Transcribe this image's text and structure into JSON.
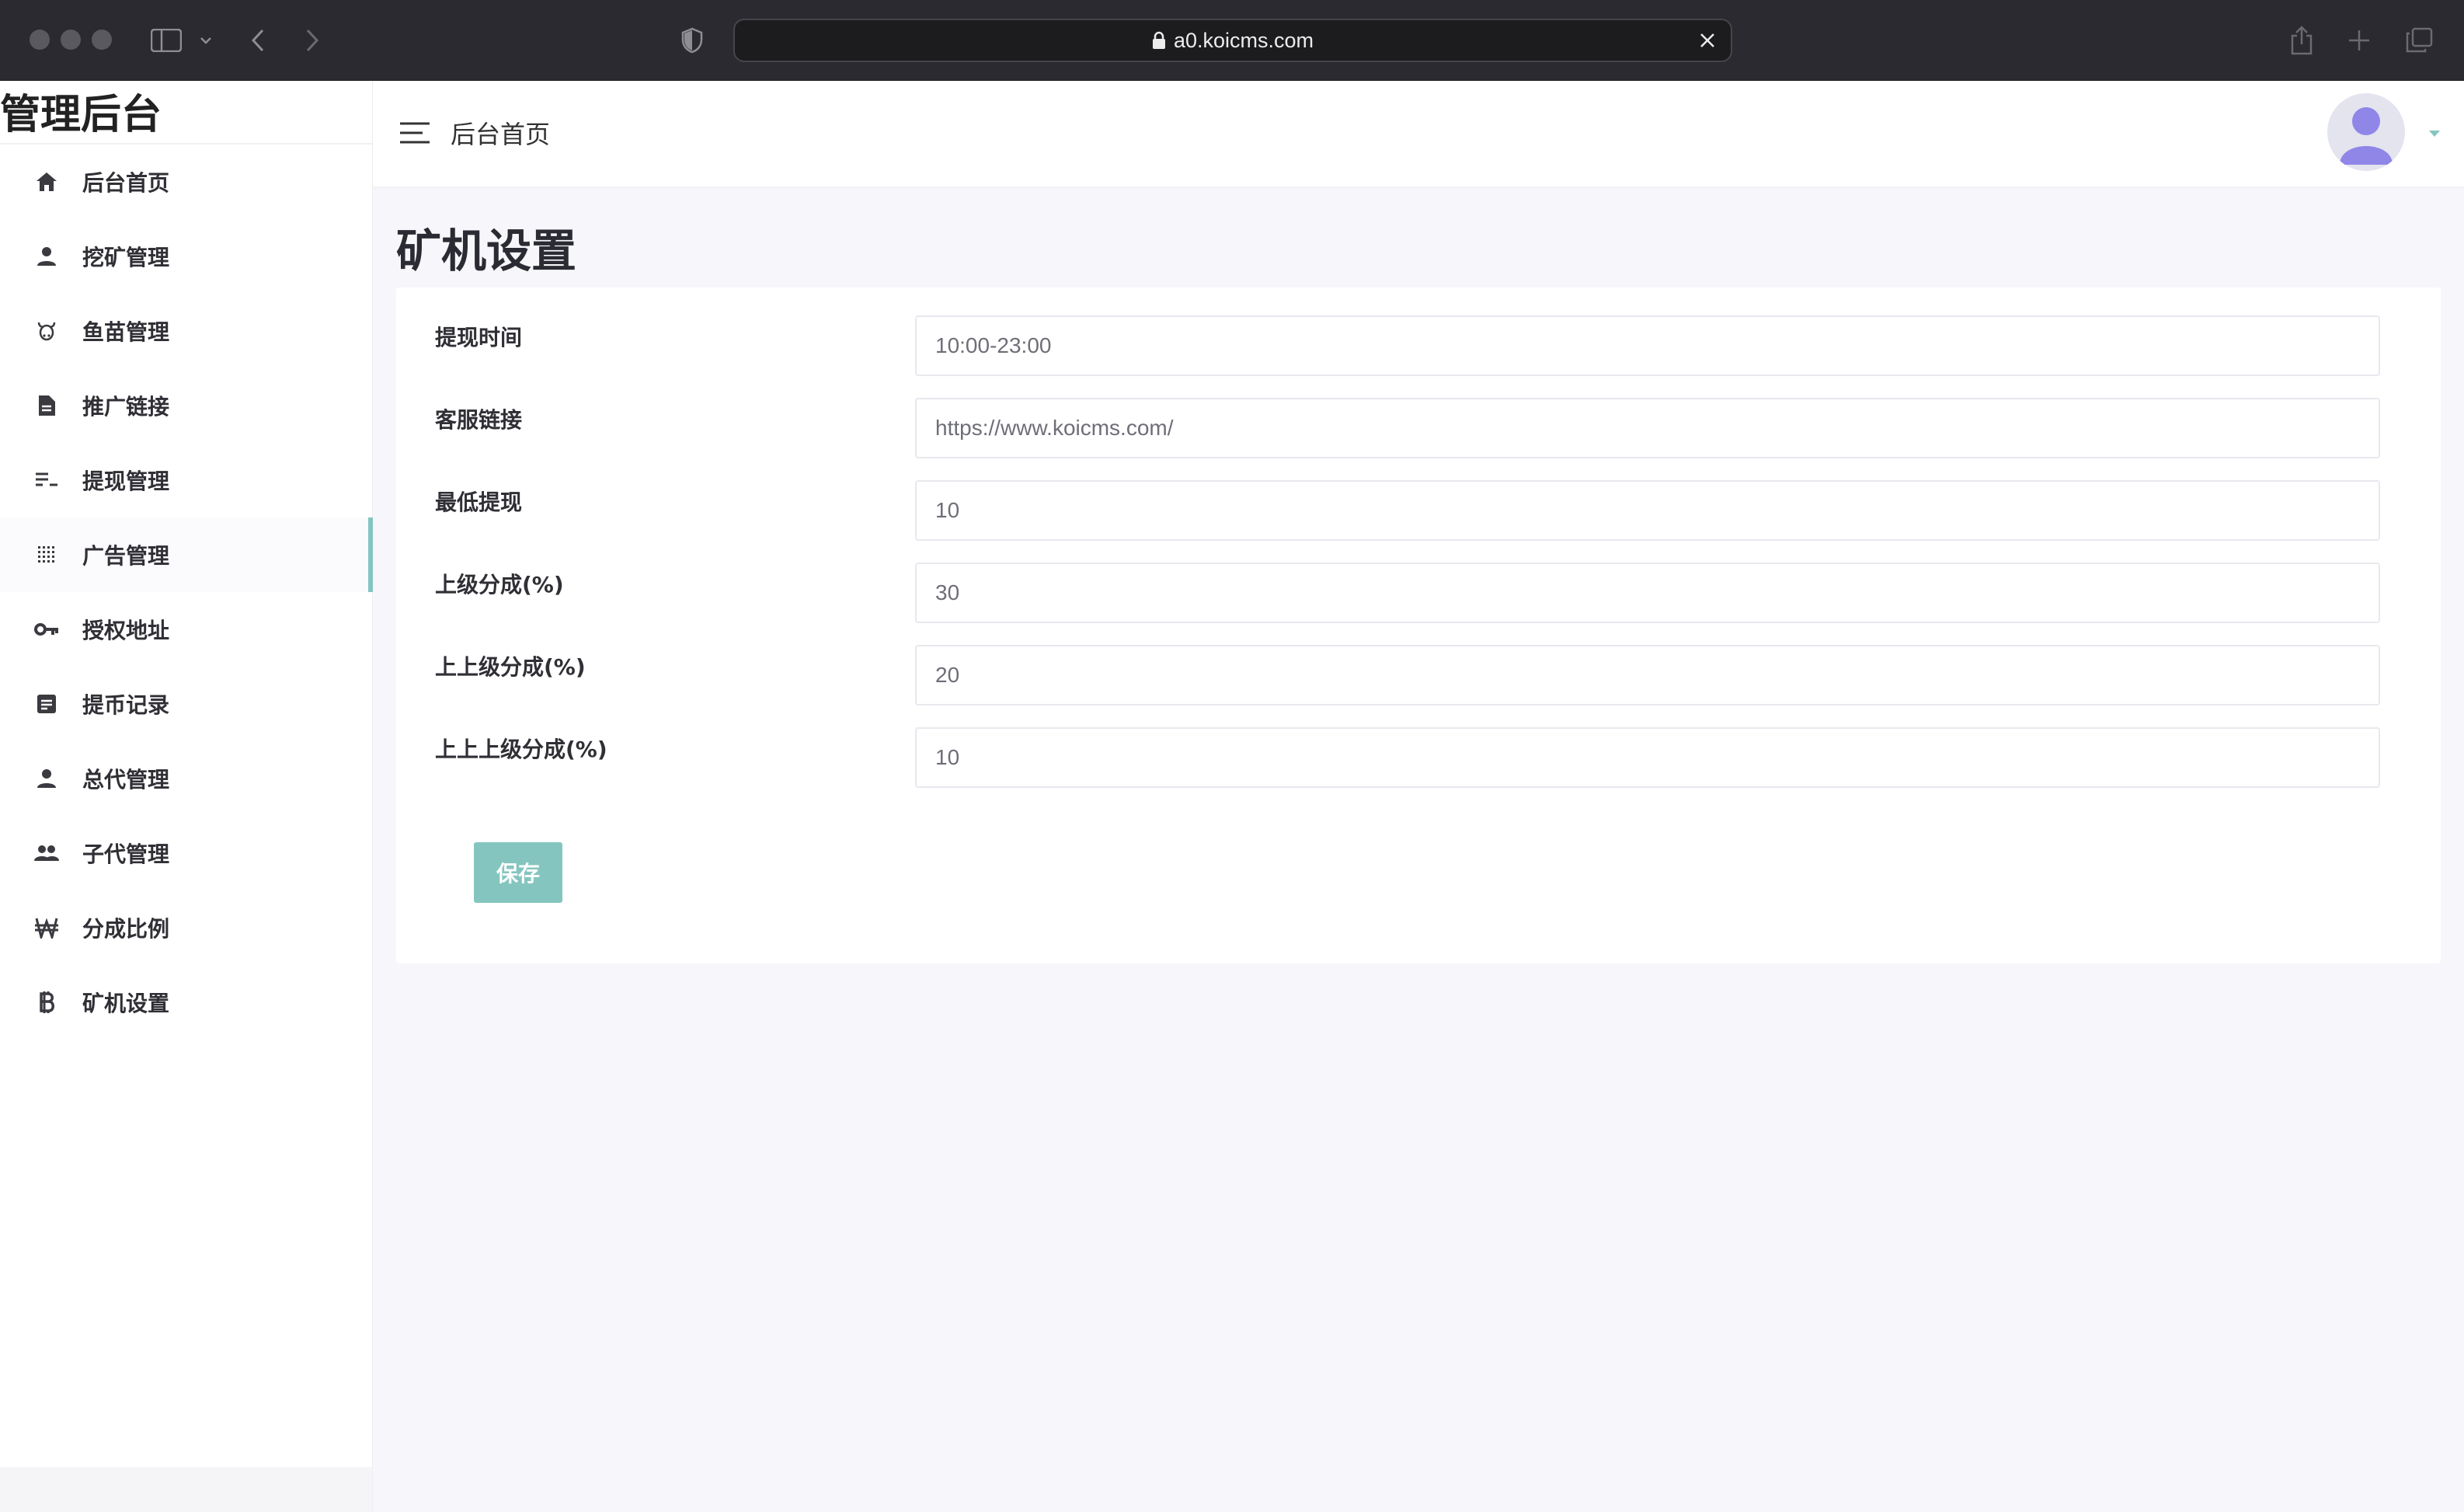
{
  "browser": {
    "url": "a0.koicms.com"
  },
  "sidebar": {
    "brand": "管理后台",
    "items": [
      {
        "label": "后台首页",
        "icon": "home-icon"
      },
      {
        "label": "挖矿管理",
        "icon": "person-icon"
      },
      {
        "label": "鱼苗管理",
        "icon": "cow-icon"
      },
      {
        "label": "推广链接",
        "icon": "document-icon"
      },
      {
        "label": "提现管理",
        "icon": "list-icon"
      },
      {
        "label": "广告管理",
        "icon": "grid-icon",
        "active": true
      },
      {
        "label": "授权地址",
        "icon": "key-icon"
      },
      {
        "label": "提币记录",
        "icon": "note-icon"
      },
      {
        "label": "总代管理",
        "icon": "person-icon"
      },
      {
        "label": "子代管理",
        "icon": "people-icon"
      },
      {
        "label": "分成比例",
        "icon": "won-icon"
      },
      {
        "label": "矿机设置",
        "icon": "bitcoin-icon"
      }
    ]
  },
  "header": {
    "title": "后台首页"
  },
  "main": {
    "page_title": "矿机设置",
    "fields": [
      {
        "label": "提现时间",
        "value": "10:00-23:00"
      },
      {
        "label": "客服链接",
        "value": "https://www.koicms.com/"
      },
      {
        "label": "最低提现",
        "value": "10"
      },
      {
        "label": "上级分成(%)",
        "value": "30"
      },
      {
        "label": "上上级分成(%)",
        "value": "20"
      },
      {
        "label": "上上上级分成(%)",
        "value": "10"
      }
    ],
    "save_label": "保存"
  },
  "colors": {
    "accent": "#84c6bf",
    "chrome": "#2b2a30",
    "avatar": "#8f86e8"
  }
}
